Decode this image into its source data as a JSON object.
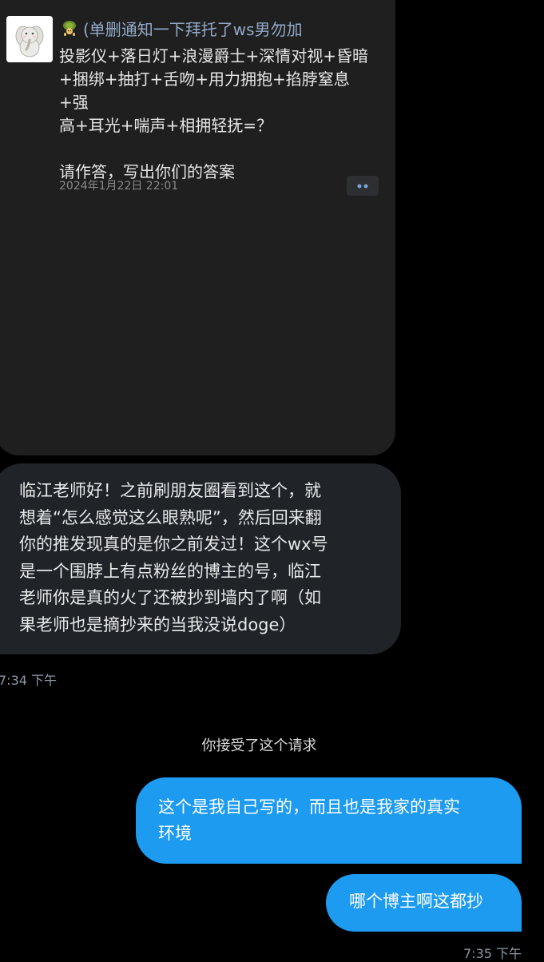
{
  "shared_card": {
    "avatar_icon": "elephant-plush-icon",
    "name_emoji_icon": "turtle-emoji-icon",
    "author_name": "(单删通知一下拜托了ws男勿加",
    "post_lines": [
      "投影仪+落日灯+浪漫爵士+深情对视+昏暗",
      "+捆绑+抽打+舌吻+用力拥抱+掐脖窒息+强",
      "高+耳光+喘声+相拥轻抚=？"
    ],
    "post_question": "请作答，写出你们的答案",
    "timestamp": "2024年1月22日 22:01",
    "more_icon": "more-dots-icon"
  },
  "incoming_message": {
    "lines": [
      "临江老师好！之前刷朋友圈看到这个，就",
      "想着“怎么感觉这么眼熟呢”，然后回来翻",
      "你的推发现真的是你之前发过！这个wx号",
      "是一个围脖上有点粉丝的博主的号，临江",
      "老师你是真的火了还被抄到墙内了啊（如",
      "果老师也是摘抄来的当我没说doge）"
    ],
    "time": "7:34 下午"
  },
  "system_note": "你接受了这个请求",
  "outgoing_messages": [
    {
      "lines": [
        "这个是我自己写的，而且也是我家的真实",
        "环境"
      ]
    },
    {
      "lines": [
        "哪个博主啊这都抄"
      ]
    }
  ],
  "outgoing_time": "7:35 下午",
  "colors": {
    "background": "#000000",
    "card_bg": "#1f1f1f",
    "incoming_bubble": "#202327",
    "outgoing_bubble": "#1d9bf0",
    "name_color": "#93a9c9",
    "time_color": "#8b98a5"
  }
}
